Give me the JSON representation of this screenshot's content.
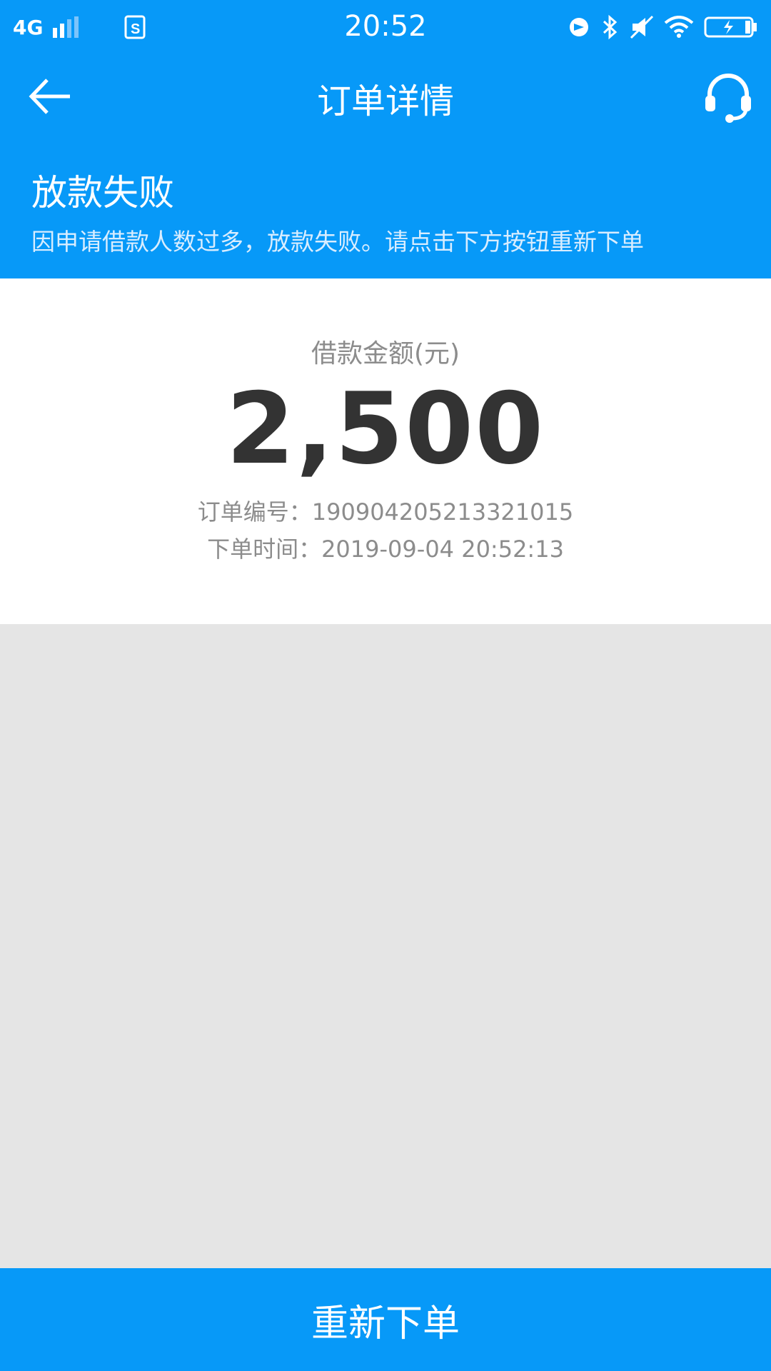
{
  "status_bar": {
    "network": "4G",
    "time": "20:52",
    "icons": [
      "signal-icon",
      "sim-icon",
      "location-icon",
      "bluetooth-icon",
      "mute-icon",
      "wifi-icon",
      "battery-charging-icon"
    ]
  },
  "nav": {
    "title": "订单详情",
    "back_icon": "arrow-left-icon",
    "service_icon": "headset-icon"
  },
  "banner": {
    "title": "放款失败",
    "message": "因申请借款人数过多，放款失败。请点击下方按钮重新下单"
  },
  "order": {
    "amount_label": "借款金额(元)",
    "amount": "2,500",
    "order_no": "订单编号：190904205213321015",
    "order_time": "下单时间：2019-09-04 20:52:13"
  },
  "action": {
    "reorder_label": "重新下单"
  },
  "colors": {
    "primary": "#0799f8",
    "background": "#e5e5e5",
    "text_dark": "#333333",
    "text_gray": "#8c8c8c"
  }
}
